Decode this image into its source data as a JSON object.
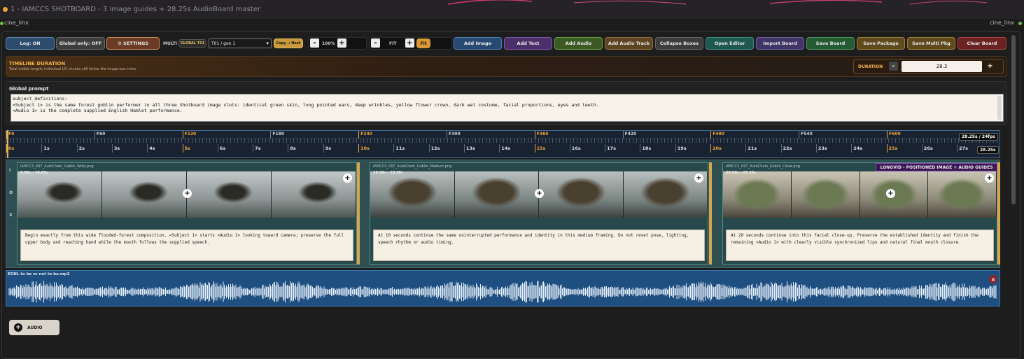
{
  "window": {
    "title": "1 - IAMCCS SHOTBOARD - 3 image guides + 28.25s AudioBoard master",
    "left_label": "cine_linx",
    "right_label": "cine_linx"
  },
  "toolbar": {
    "log": "Log: ON",
    "global_only": "Global only: OFF",
    "settings": "⚙ SETTINGS",
    "multi": "MULTI",
    "global_t01": "GLOBAL T01",
    "select_value": "T01 / gen 1",
    "copy_next": "Copy → Next",
    "zoom_minus": "-",
    "zoom": "100%",
    "zoom_plus": "+",
    "fit_minus": "-",
    "fit_label": "FIT",
    "fit_plus": "+",
    "fit_button": "Fit",
    "add_image": "Add Image",
    "add_text": "Add Text",
    "add_audio": "Add Audio",
    "add_audio_track": "Add Audio Track",
    "collapse_boxes": "Collapse Boxes",
    "open_editor": "Open Editor",
    "import_board": "Import Board",
    "save_board": "Save Board",
    "save_package": "Save Package",
    "save_multi_pkg": "Save Multi Pkg",
    "clear_board": "Clear Board"
  },
  "duration": {
    "title": "TIMELINE DURATION",
    "subtitle": "Total visible length; individual I/O chunks still follow the image-box trims.",
    "label": "DURATION",
    "minus": "-",
    "value": "28.3",
    "plus": "+"
  },
  "global_prompt": {
    "title": "Global prompt",
    "text": "subject_definitions:\n<Subject 1> is the same forest goblin performer in all three Shotboard image slots: identical green skin, long pointed ears, deep wrinkles, yellow flower crown, dark wet costume, facial proportions, eyes and teeth.\n<Audio 1> is the complete supplied English Hamlet performance."
  },
  "ruler": {
    "frames": [
      "F0",
      "F60",
      "F120",
      "F180",
      "F240",
      "F300",
      "F360",
      "F420",
      "F480",
      "F540",
      "F600"
    ],
    "seconds": [
      "0s",
      "1s",
      "2s",
      "3s",
      "4s",
      "5s",
      "6s",
      "7s",
      "8s",
      "9s",
      "10s",
      "11s",
      "12s",
      "13s",
      "14s",
      "15s",
      "16s",
      "17s",
      "18s",
      "19s",
      "20s",
      "21s",
      "22s",
      "23s",
      "24s",
      "25s",
      "26s",
      "27s"
    ],
    "fps_badge": "28.25s / 24fps",
    "end_badge": "28.25s"
  },
  "track_labels": [
    "I",
    "O",
    "X"
  ],
  "longvid_tag": "LONGVID - POSITIONED IMAGE + AUDIO GUIDES",
  "clips": [
    {
      "name": "IAMCCS_R97_AutoChain_Goblin_Wide.png",
      "range": "0.00s - 10.00s",
      "prompt": "Begin exactly from this wide flooded-forest composition. <Subject 1> starts <Audio 1> looking toward camera; preserve the full upper body and reaching hand while the mouth follows the supplied speech."
    },
    {
      "name": "IAMCCS_R97_AutoChain_Goblin_Medium.png",
      "range": "10.00s - 20.00s",
      "prompt": "At 10 seconds continue the same uninterrupted performance and identity in this medium framing. Do not reset pose, lighting, speech rhythm or audio timing."
    },
    {
      "name": "IAMCCS_R97_AutoChain_Goblin_Close.png",
      "range": "20.00s - 28.25s",
      "prompt": "At 20 seconds continue into this facial close-up. Preserve the established identity and finish the remaining <Audio 1> with clearly visible synchronized lips and natural final mouth closure."
    }
  ],
  "audio_track": {
    "name": "EGNL to be or not to be.mp3",
    "close": "×"
  },
  "add_audio": {
    "plus": "+",
    "label": "AUDIO"
  },
  "colors": {
    "accent_orange": "#f0a63a",
    "audio_blue": "#1f4f80",
    "clip_teal": "#2e4f52"
  }
}
